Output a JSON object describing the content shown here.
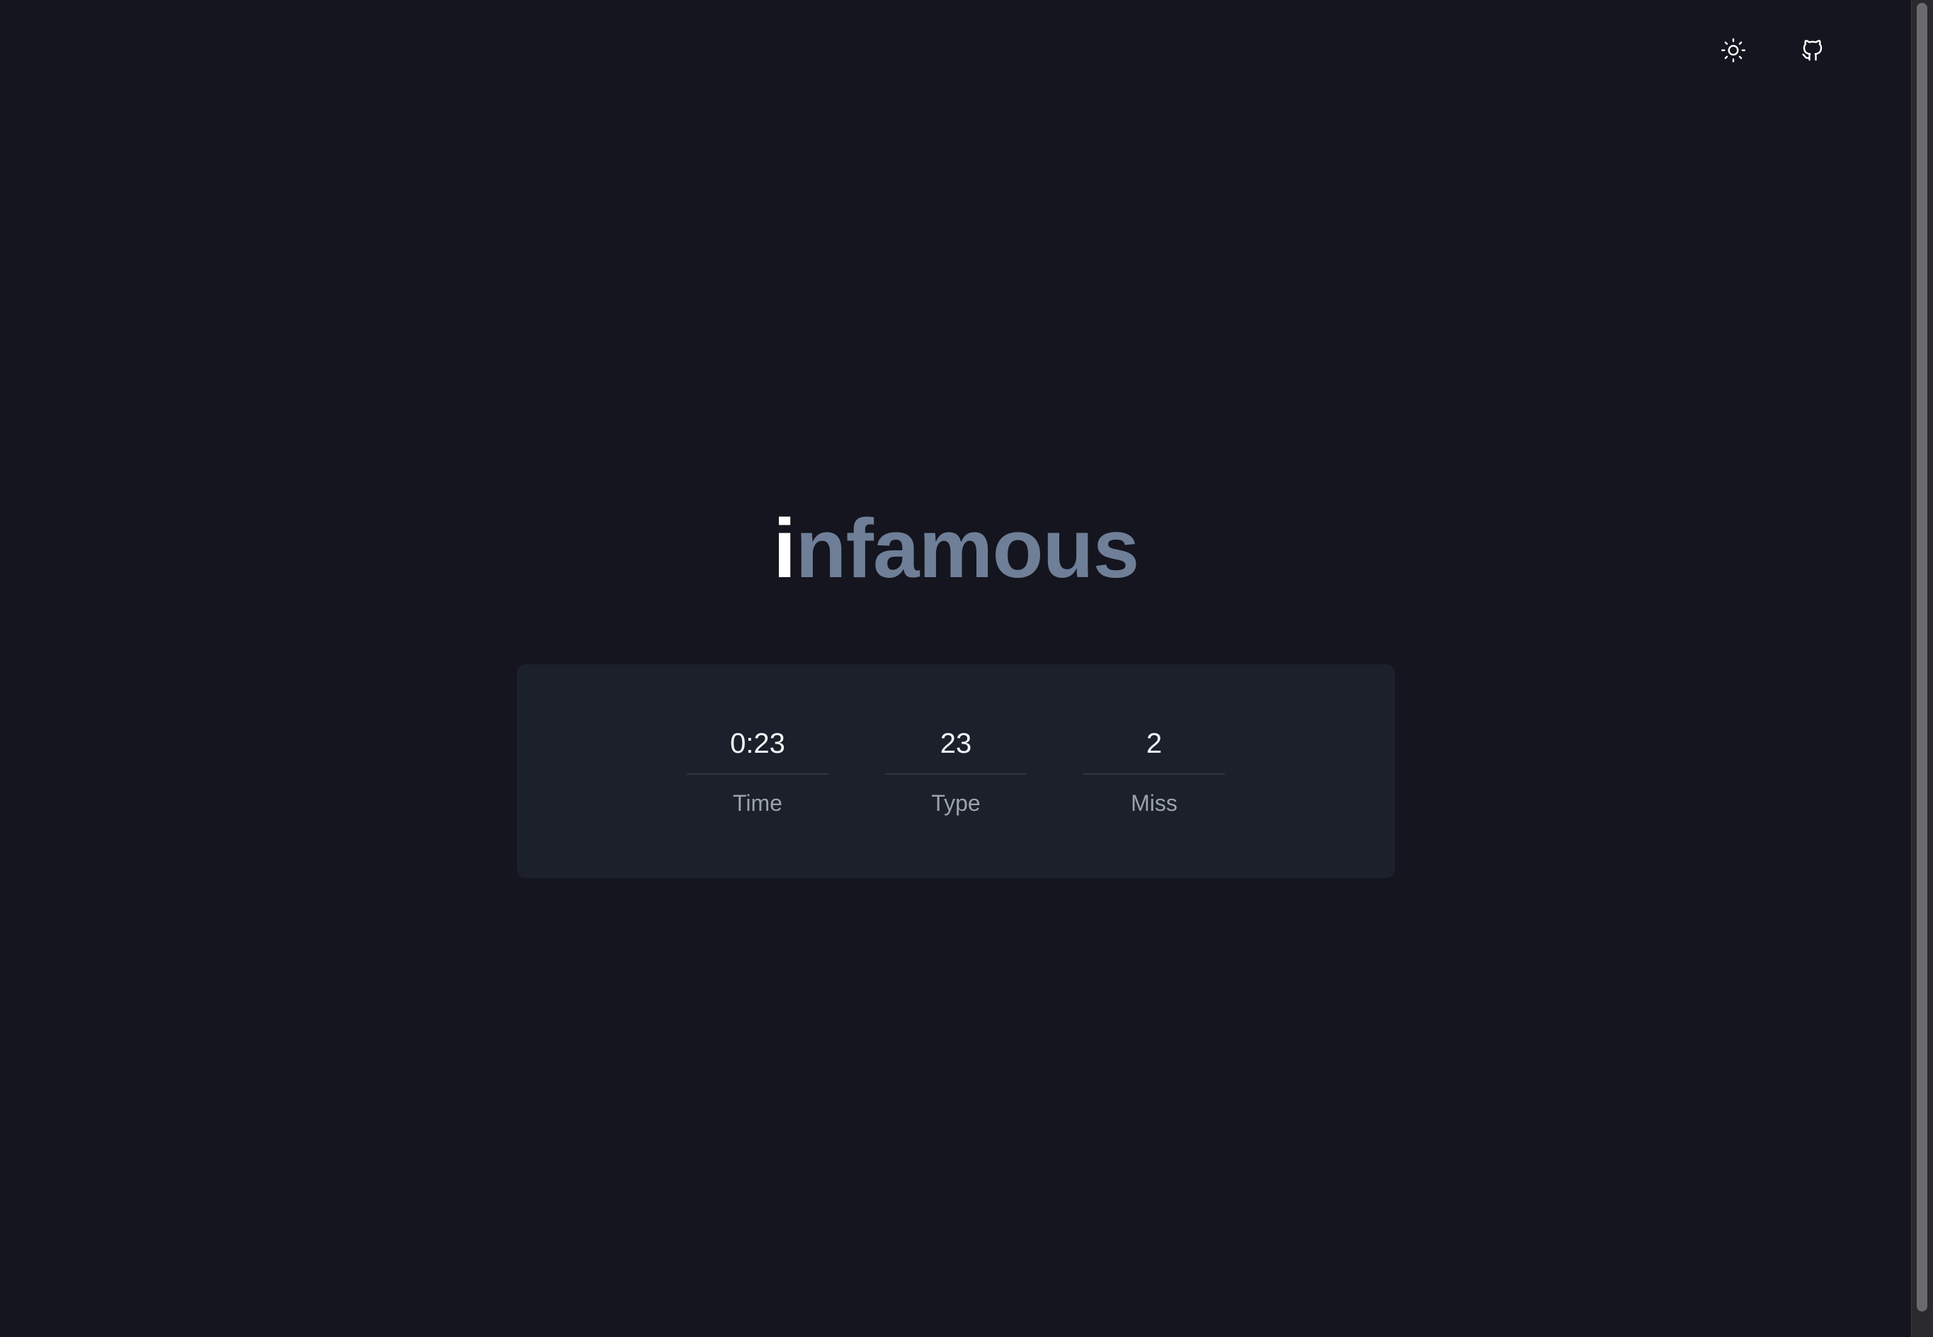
{
  "toolbar": {
    "theme_icon": "sun-icon",
    "github_icon": "github-icon"
  },
  "word": {
    "typed": "i",
    "remaining": "nfamous"
  },
  "stats": [
    {
      "value": "0:23",
      "label": "Time"
    },
    {
      "value": "23",
      "label": "Type"
    },
    {
      "value": "2",
      "label": "Miss"
    }
  ],
  "colors": {
    "background": "#14151e",
    "panel": "#1b202b",
    "typed": "#ffffff",
    "remaining": "#6f7f98"
  }
}
